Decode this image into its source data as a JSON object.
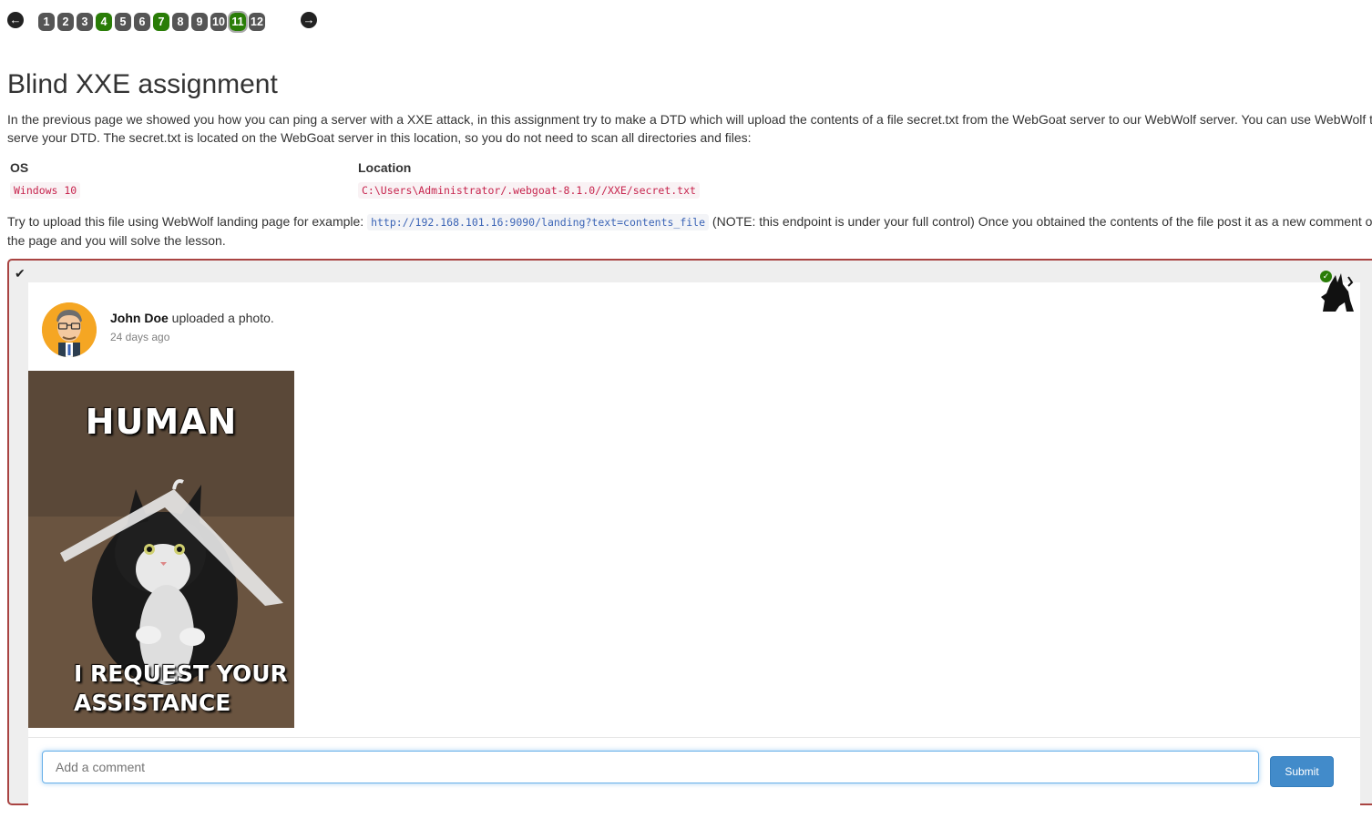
{
  "nav": {
    "prev_icon": "arrow-left-icon",
    "next_icon": "arrow-right-icon",
    "pages": [
      {
        "label": "1",
        "status": "unsolved"
      },
      {
        "label": "2",
        "status": "unsolved"
      },
      {
        "label": "3",
        "status": "unsolved"
      },
      {
        "label": "4",
        "status": "solved"
      },
      {
        "label": "5",
        "status": "unsolved"
      },
      {
        "label": "6",
        "status": "unsolved"
      },
      {
        "label": "7",
        "status": "solved"
      },
      {
        "label": "8",
        "status": "unsolved"
      },
      {
        "label": "9",
        "status": "unsolved"
      },
      {
        "label": "10",
        "status": "unsolved"
      },
      {
        "label": "11",
        "status": "current"
      },
      {
        "label": "12",
        "status": "unsolved"
      }
    ]
  },
  "lesson": {
    "title": "Blind XXE assignment",
    "intro": "In the previous page we showed you how you can ping a server with a XXE attack, in this assignment try to make a DTD which will upload the contents of a file secret.txt from the WebGoat server to our WebWolf server. You can use WebWolf to serve your DTD. The secret.txt is located on the WebGoat server in this location, so you do not need to scan all directories and files:",
    "table": {
      "headers": [
        "OS",
        "Location"
      ],
      "rows": [
        [
          "Windows 10",
          "C:\\Users\\Administrator/.webgoat-8.1.0//XXE/secret.txt"
        ]
      ]
    },
    "upload_prefix": "Try to upload this file using WebWolf landing page for example: ",
    "upload_url": "http://192.168.101.16:9090/landing?text=contents_file",
    "upload_suffix": " (NOTE: this endpoint is under your full control) Once you obtained the contents of the file post it as a new comment on the page and you will solve the lesson."
  },
  "post": {
    "author": "John Doe",
    "action": " uploaded a photo.",
    "time": "24 days ago",
    "photo_text_top": "HUMAN",
    "photo_text_bottom_1": "I REQUEST YOUR",
    "photo_text_bottom_2": "ASSISTANCE",
    "comment_placeholder": "Add a comment",
    "submit_label": "Submit"
  },
  "colors": {
    "solved": "#2a7d07",
    "unsolved": "#555555",
    "panel_border": "#a94442",
    "button": "#428bca"
  }
}
